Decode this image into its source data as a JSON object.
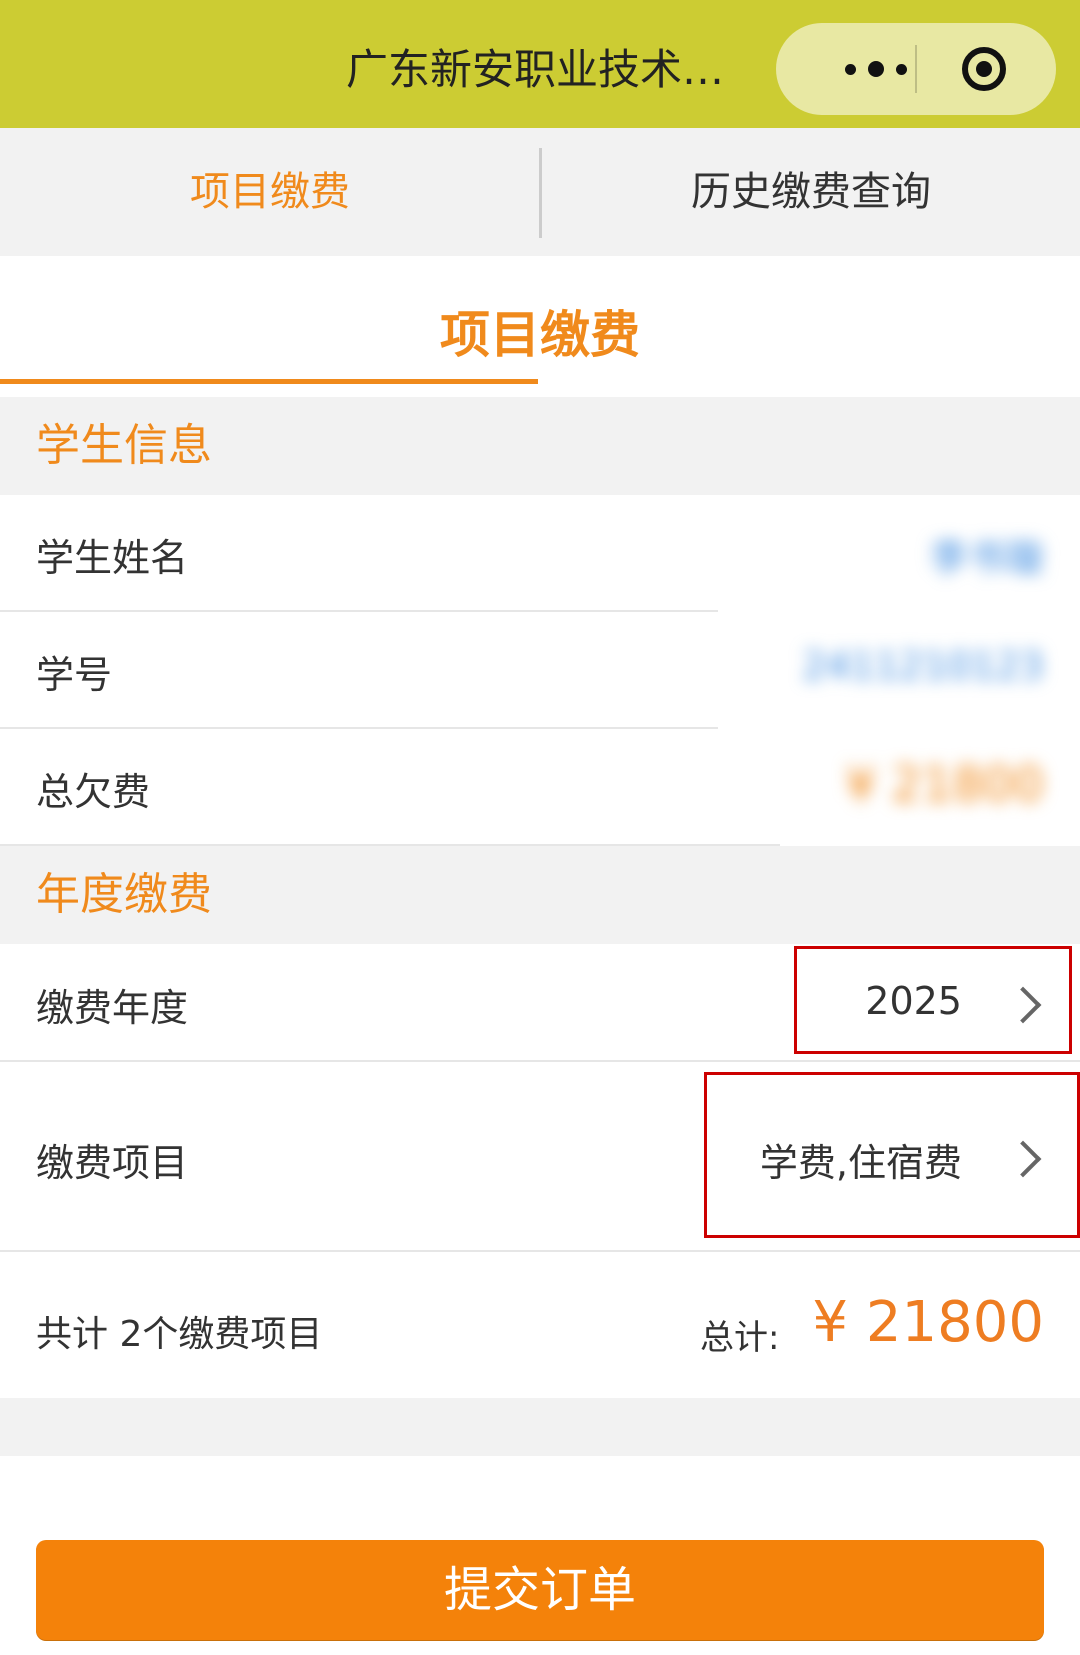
{
  "header": {
    "app_title": "广东新安职业技术…",
    "more_icon": "more-dots-icon",
    "close_icon": "target-close-icon"
  },
  "tabs": [
    {
      "label": "项目缴费",
      "active": true
    },
    {
      "label": "历史缴费查询",
      "active": false
    }
  ],
  "page_title": "项目缴费",
  "student_section": {
    "title": "学生信息",
    "rows": [
      {
        "label": "学生姓名",
        "value": "李书璇"
      },
      {
        "label": "学号",
        "value": "2411210123"
      },
      {
        "label": "总欠费",
        "value": "¥ 21800"
      }
    ]
  },
  "annual_section": {
    "title": "年度缴费",
    "year_label": "缴费年度",
    "year_value": "2025",
    "items_label": "缴费项目",
    "items_value": "学费,住宿费"
  },
  "summary": {
    "count_text": "共计 2个缴费项目",
    "total_label": "总计:",
    "total_value": "¥ 21800"
  },
  "submit_label": "提交订单",
  "colors": {
    "header_bg": "#cccc33",
    "accent": "#f08a1c",
    "button": "#f4820a",
    "highlight_box": "#cc0000"
  }
}
